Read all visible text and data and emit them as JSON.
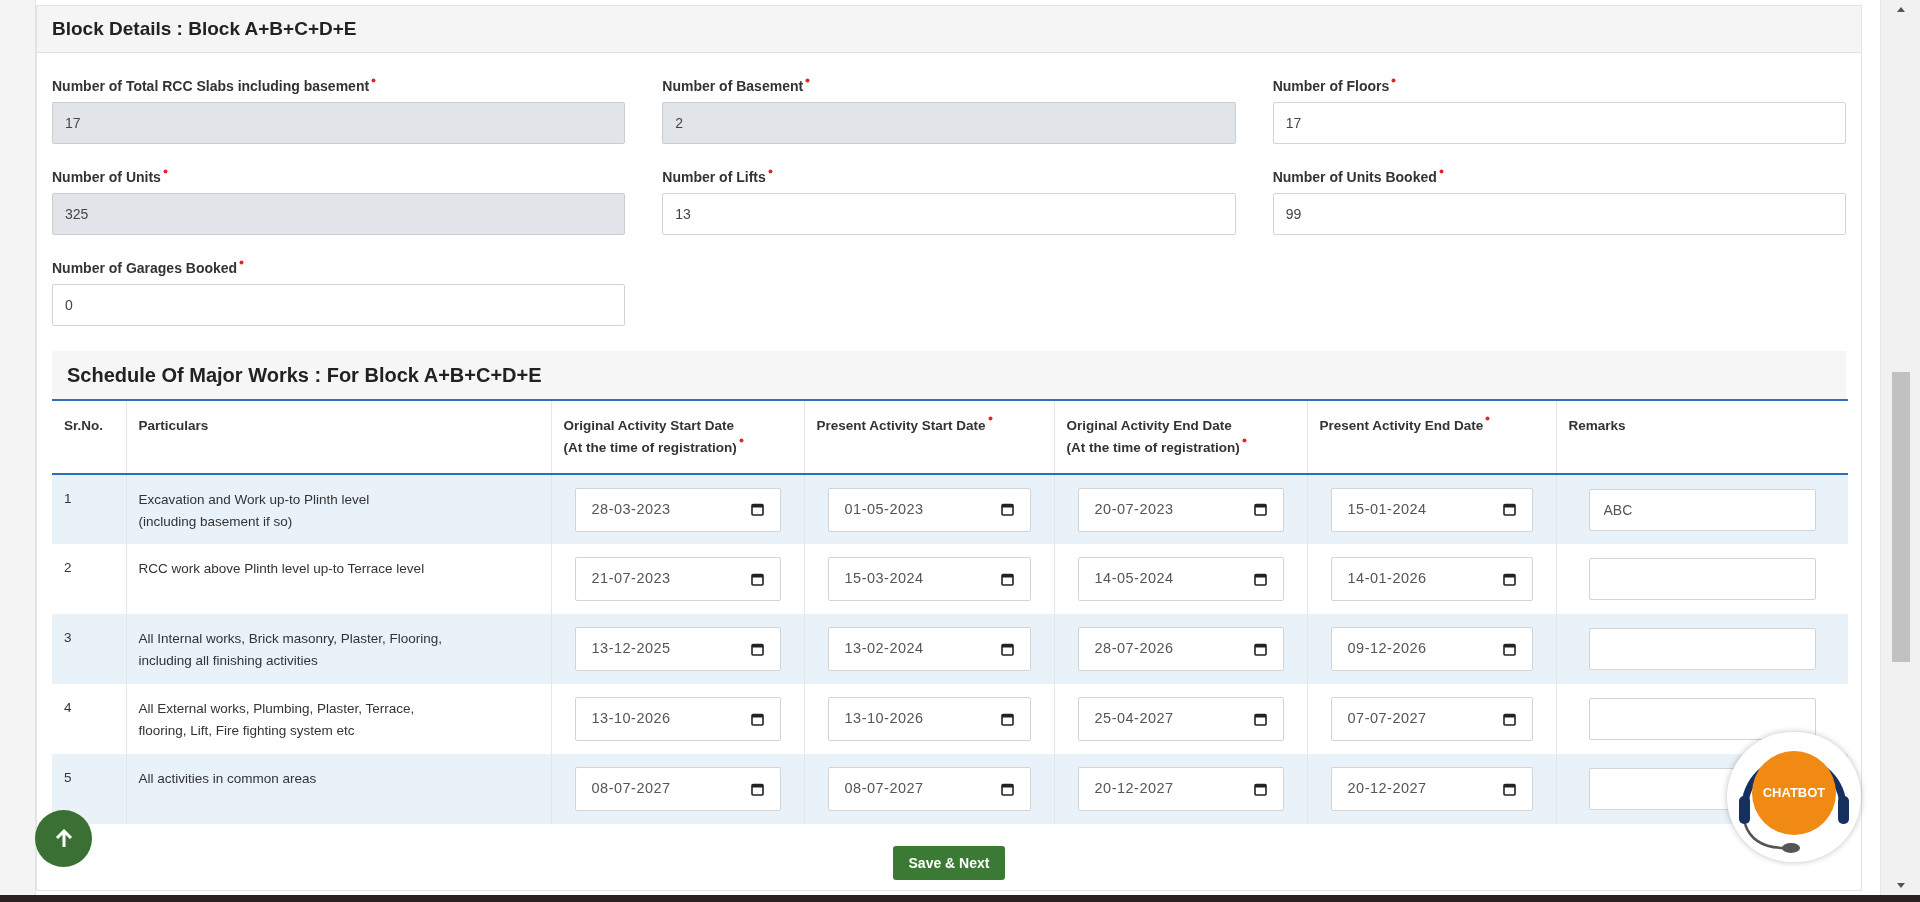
{
  "block_details": {
    "title": "Block Details : Block A+B+C+D+E",
    "fields": [
      {
        "label": "Number of Total RCC Slabs including basement",
        "required": true,
        "value": "17",
        "readonly": true
      },
      {
        "label": "Number of Basement",
        "required": true,
        "value": "2",
        "readonly": true
      },
      {
        "label": "Number of Floors",
        "required": true,
        "value": "17",
        "readonly": false
      },
      {
        "label": "Number of Units",
        "required": true,
        "value": "325",
        "readonly": true
      },
      {
        "label": "Number of Lifts",
        "required": true,
        "value": "13",
        "readonly": false
      },
      {
        "label": "Number of Units Booked",
        "required": true,
        "value": "99",
        "readonly": false
      },
      {
        "label": "Number of Garages Booked",
        "required": true,
        "value": "0",
        "readonly": false
      }
    ]
  },
  "schedule": {
    "title": "Schedule Of Major Works : For Block A+B+C+D+E",
    "columns": [
      {
        "label": "Sr.No.",
        "required": false
      },
      {
        "label": "Particulars",
        "required": false
      },
      {
        "label": "Original Activity Start Date\n(At the time of registration)",
        "required": true
      },
      {
        "label": "Present Activity Start Date",
        "required": true
      },
      {
        "label": "Original Activity End Date\n(At the time of registration)",
        "required": true
      },
      {
        "label": "Present Activity End Date",
        "required": true
      },
      {
        "label": "Remarks",
        "required": false
      }
    ],
    "rows": [
      {
        "sr_no": "1",
        "particulars": "Excavation and Work up-to Plinth level\n(including basement if so)",
        "dates": [
          "28-03-2023",
          "01-05-2023",
          "20-07-2023",
          "15-01-2024"
        ],
        "remarks": "ABC"
      },
      {
        "sr_no": "2",
        "particulars": "RCC work above Plinth level up-to Terrace level",
        "dates": [
          "21-07-2023",
          "15-03-2024",
          "14-05-2024",
          "14-01-2026"
        ],
        "remarks": ""
      },
      {
        "sr_no": "3",
        "particulars": "All Internal works, Brick masonry, Plaster, Flooring,\nincluding all finishing activities",
        "dates": [
          "13-12-2025",
          "13-02-2024",
          "28-07-2026",
          "09-12-2026"
        ],
        "remarks": ""
      },
      {
        "sr_no": "4",
        "particulars": "All External works, Plumbing, Plaster, Terrace,\nflooring, Lift, Fire fighting system etc",
        "dates": [
          "13-10-2026",
          "13-10-2026",
          "25-04-2027",
          "07-07-2027"
        ],
        "remarks": ""
      },
      {
        "sr_no": "5",
        "particulars": "All activities in common areas",
        "dates": [
          "08-07-2027",
          "08-07-2027",
          "20-12-2027",
          "20-12-2027"
        ],
        "remarks": ""
      }
    ]
  },
  "save_button": "Save & Next",
  "chatbot": {
    "label": "CHATBOT"
  }
}
